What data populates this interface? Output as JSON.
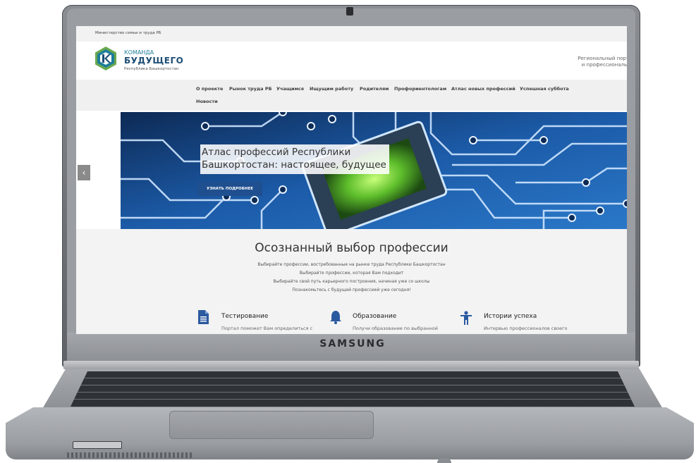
{
  "laptop": {
    "brand": "SAMSUNG"
  },
  "site": {
    "ministry": "Министерство семьи и труда РБ",
    "logo": {
      "top": "КОМАНДА",
      "main": "БУДУЩЕГО",
      "sub": "Республика Башкортостан"
    },
    "portal_desc": [
      "Региональный портал по с",
      "и профессиональной ори"
    ]
  },
  "nav": {
    "items": [
      "О проекте",
      "Рынок труда РБ",
      "Учащимся",
      "Ищущим работу",
      "Родителям",
      "Профориентологам",
      "Атлас новых профессий",
      "Успешная суббота",
      "Новости"
    ]
  },
  "slider": {
    "prev_icon": "‹",
    "title": [
      "Атлас профессий Республики",
      "Башкортостан: настоящее, будущее"
    ],
    "button": "УЗНАТЬ ПОДРОБНЕЕ"
  },
  "intro": {
    "title": "Осознанный выбор профессии",
    "lines": [
      "Выбирайте профессии, востребованные на рынке труда Республики Башкортостан",
      "Выбирайте профессии, которая Вам подходит",
      "Выбирайте свой путь карьерного построения, начиная уже со школы",
      "Познакомьтесь с будущей профессией уже сегодня!"
    ]
  },
  "features": [
    {
      "icon": "document-icon",
      "title": "Тестирование",
      "text": "Портал поможет Вам определиться с"
    },
    {
      "icon": "bell-icon",
      "title": "Образование",
      "text": "Получи образование по выбранной"
    },
    {
      "icon": "person-icon",
      "title": "Истории успеха",
      "text": "Интервью профессионалов своего"
    }
  ],
  "colors": {
    "accent": "#1f4f8f",
    "logo_blue": "#1d4d74",
    "logo_green": "#6aa84f",
    "icon_blue": "#2c5aa0"
  }
}
